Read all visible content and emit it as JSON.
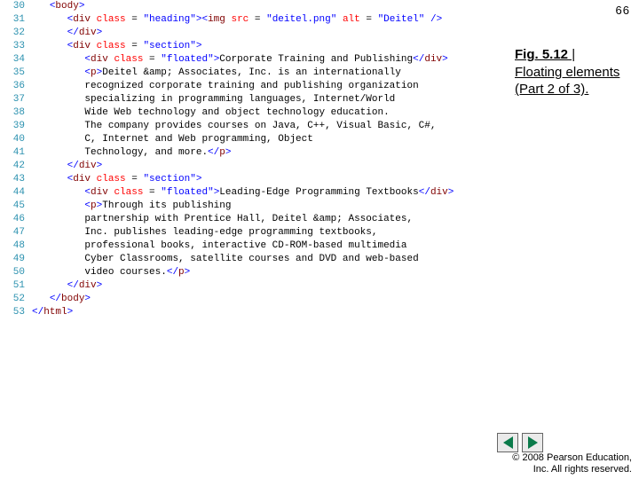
{
  "page_number": "66",
  "caption": {
    "fig": "Fig. 5.12",
    "sep": " | ",
    "title": "Floating elements (Part 2 of 3)."
  },
  "code_lines": [
    {
      "n": "30",
      "indent": "   ",
      "tokens": [
        {
          "t": "tag",
          "v": "<"
        },
        {
          "t": "tagname",
          "v": "body"
        },
        {
          "t": "tag",
          "v": ">"
        }
      ]
    },
    {
      "n": "31",
      "indent": "      ",
      "tokens": [
        {
          "t": "tag",
          "v": "<"
        },
        {
          "t": "tagname",
          "v": "div "
        },
        {
          "t": "attr",
          "v": "class"
        },
        {
          "t": "txt",
          "v": " = "
        },
        {
          "t": "val",
          "v": "\"heading\""
        },
        {
          "t": "tag",
          "v": "><"
        },
        {
          "t": "tagname",
          "v": "img "
        },
        {
          "t": "attr",
          "v": "src"
        },
        {
          "t": "txt",
          "v": " = "
        },
        {
          "t": "val",
          "v": "\"deitel.png\""
        },
        {
          "t": "txt",
          "v": " "
        },
        {
          "t": "attr",
          "v": "alt"
        },
        {
          "t": "txt",
          "v": " = "
        },
        {
          "t": "val",
          "v": "\"Deitel\""
        },
        {
          "t": "txt",
          "v": " "
        },
        {
          "t": "tag",
          "v": "/>"
        }
      ]
    },
    {
      "n": "32",
      "indent": "      ",
      "tokens": [
        {
          "t": "tag",
          "v": "</"
        },
        {
          "t": "tagname",
          "v": "div"
        },
        {
          "t": "tag",
          "v": ">"
        }
      ]
    },
    {
      "n": "33",
      "indent": "      ",
      "tokens": [
        {
          "t": "tag",
          "v": "<"
        },
        {
          "t": "tagname",
          "v": "div "
        },
        {
          "t": "attr",
          "v": "class"
        },
        {
          "t": "txt",
          "v": " = "
        },
        {
          "t": "val",
          "v": "\"section\""
        },
        {
          "t": "tag",
          "v": ">"
        }
      ]
    },
    {
      "n": "34",
      "indent": "         ",
      "tokens": [
        {
          "t": "tag",
          "v": "<"
        },
        {
          "t": "tagname",
          "v": "div "
        },
        {
          "t": "attr",
          "v": "class"
        },
        {
          "t": "txt",
          "v": " = "
        },
        {
          "t": "val",
          "v": "\"floated\""
        },
        {
          "t": "tag",
          "v": ">"
        },
        {
          "t": "txt",
          "v": "Corporate Training and Publishing"
        },
        {
          "t": "tag",
          "v": "</"
        },
        {
          "t": "tagname",
          "v": "div"
        },
        {
          "t": "tag",
          "v": ">"
        }
      ]
    },
    {
      "n": "35",
      "indent": "         ",
      "tokens": [
        {
          "t": "tag",
          "v": "<"
        },
        {
          "t": "tagname",
          "v": "p"
        },
        {
          "t": "tag",
          "v": ">"
        },
        {
          "t": "txt",
          "v": "Deitel &amp; Associates, Inc. is an internationally"
        }
      ]
    },
    {
      "n": "36",
      "indent": "         ",
      "tokens": [
        {
          "t": "txt",
          "v": "recognized corporate training and publishing organization"
        }
      ]
    },
    {
      "n": "37",
      "indent": "         ",
      "tokens": [
        {
          "t": "txt",
          "v": "specializing in programming languages, Internet/World"
        }
      ]
    },
    {
      "n": "38",
      "indent": "         ",
      "tokens": [
        {
          "t": "txt",
          "v": "Wide Web technology and object technology education."
        }
      ]
    },
    {
      "n": "39",
      "indent": "         ",
      "tokens": [
        {
          "t": "txt",
          "v": "The company provides courses on Java, C++, Visual Basic, C#,"
        }
      ]
    },
    {
      "n": "40",
      "indent": "         ",
      "tokens": [
        {
          "t": "txt",
          "v": "C, Internet and Web programming, Object"
        }
      ]
    },
    {
      "n": "41",
      "indent": "         ",
      "tokens": [
        {
          "t": "txt",
          "v": "Technology, and more."
        },
        {
          "t": "tag",
          "v": "</"
        },
        {
          "t": "tagname",
          "v": "p"
        },
        {
          "t": "tag",
          "v": ">"
        }
      ]
    },
    {
      "n": "42",
      "indent": "      ",
      "tokens": [
        {
          "t": "tag",
          "v": "</"
        },
        {
          "t": "tagname",
          "v": "div"
        },
        {
          "t": "tag",
          "v": ">"
        }
      ]
    },
    {
      "n": "43",
      "indent": "      ",
      "tokens": [
        {
          "t": "tag",
          "v": "<"
        },
        {
          "t": "tagname",
          "v": "div "
        },
        {
          "t": "attr",
          "v": "class"
        },
        {
          "t": "txt",
          "v": " = "
        },
        {
          "t": "val",
          "v": "\"section\""
        },
        {
          "t": "tag",
          "v": ">"
        }
      ]
    },
    {
      "n": "44",
      "indent": "         ",
      "tokens": [
        {
          "t": "tag",
          "v": "<"
        },
        {
          "t": "tagname",
          "v": "div "
        },
        {
          "t": "attr",
          "v": "class"
        },
        {
          "t": "txt",
          "v": " = "
        },
        {
          "t": "val",
          "v": "\"floated\""
        },
        {
          "t": "tag",
          "v": ">"
        },
        {
          "t": "txt",
          "v": "Leading-Edge Programming Textbooks"
        },
        {
          "t": "tag",
          "v": "</"
        },
        {
          "t": "tagname",
          "v": "div"
        },
        {
          "t": "tag",
          "v": ">"
        }
      ]
    },
    {
      "n": "45",
      "indent": "         ",
      "tokens": [
        {
          "t": "tag",
          "v": "<"
        },
        {
          "t": "tagname",
          "v": "p"
        },
        {
          "t": "tag",
          "v": ">"
        },
        {
          "t": "txt",
          "v": "Through its publishing"
        }
      ]
    },
    {
      "n": "46",
      "indent": "         ",
      "tokens": [
        {
          "t": "txt",
          "v": "partnership with Prentice Hall, Deitel &amp; Associates,"
        }
      ]
    },
    {
      "n": "47",
      "indent": "         ",
      "tokens": [
        {
          "t": "txt",
          "v": "Inc. publishes leading-edge programming textbooks,"
        }
      ]
    },
    {
      "n": "48",
      "indent": "         ",
      "tokens": [
        {
          "t": "txt",
          "v": "professional books, interactive CD-ROM-based multimedia"
        }
      ]
    },
    {
      "n": "49",
      "indent": "         ",
      "tokens": [
        {
          "t": "txt",
          "v": "Cyber Classrooms, satellite courses and DVD and web-based"
        }
      ]
    },
    {
      "n": "50",
      "indent": "         ",
      "tokens": [
        {
          "t": "txt",
          "v": "video courses."
        },
        {
          "t": "tag",
          "v": "</"
        },
        {
          "t": "tagname",
          "v": "p"
        },
        {
          "t": "tag",
          "v": ">"
        }
      ]
    },
    {
      "n": "51",
      "indent": "      ",
      "tokens": [
        {
          "t": "tag",
          "v": "</"
        },
        {
          "t": "tagname",
          "v": "div"
        },
        {
          "t": "tag",
          "v": ">"
        }
      ]
    },
    {
      "n": "52",
      "indent": "   ",
      "tokens": [
        {
          "t": "tag",
          "v": "</"
        },
        {
          "t": "tagname",
          "v": "body"
        },
        {
          "t": "tag",
          "v": ">"
        }
      ]
    },
    {
      "n": "53",
      "indent": "",
      "tokens": [
        {
          "t": "tag",
          "v": "</"
        },
        {
          "t": "tagname",
          "v": "html"
        },
        {
          "t": "tag",
          "v": ">"
        }
      ]
    }
  ],
  "footer": {
    "line1": "© 2008 Pearson Education,",
    "line2": "Inc.  All rights reserved."
  }
}
